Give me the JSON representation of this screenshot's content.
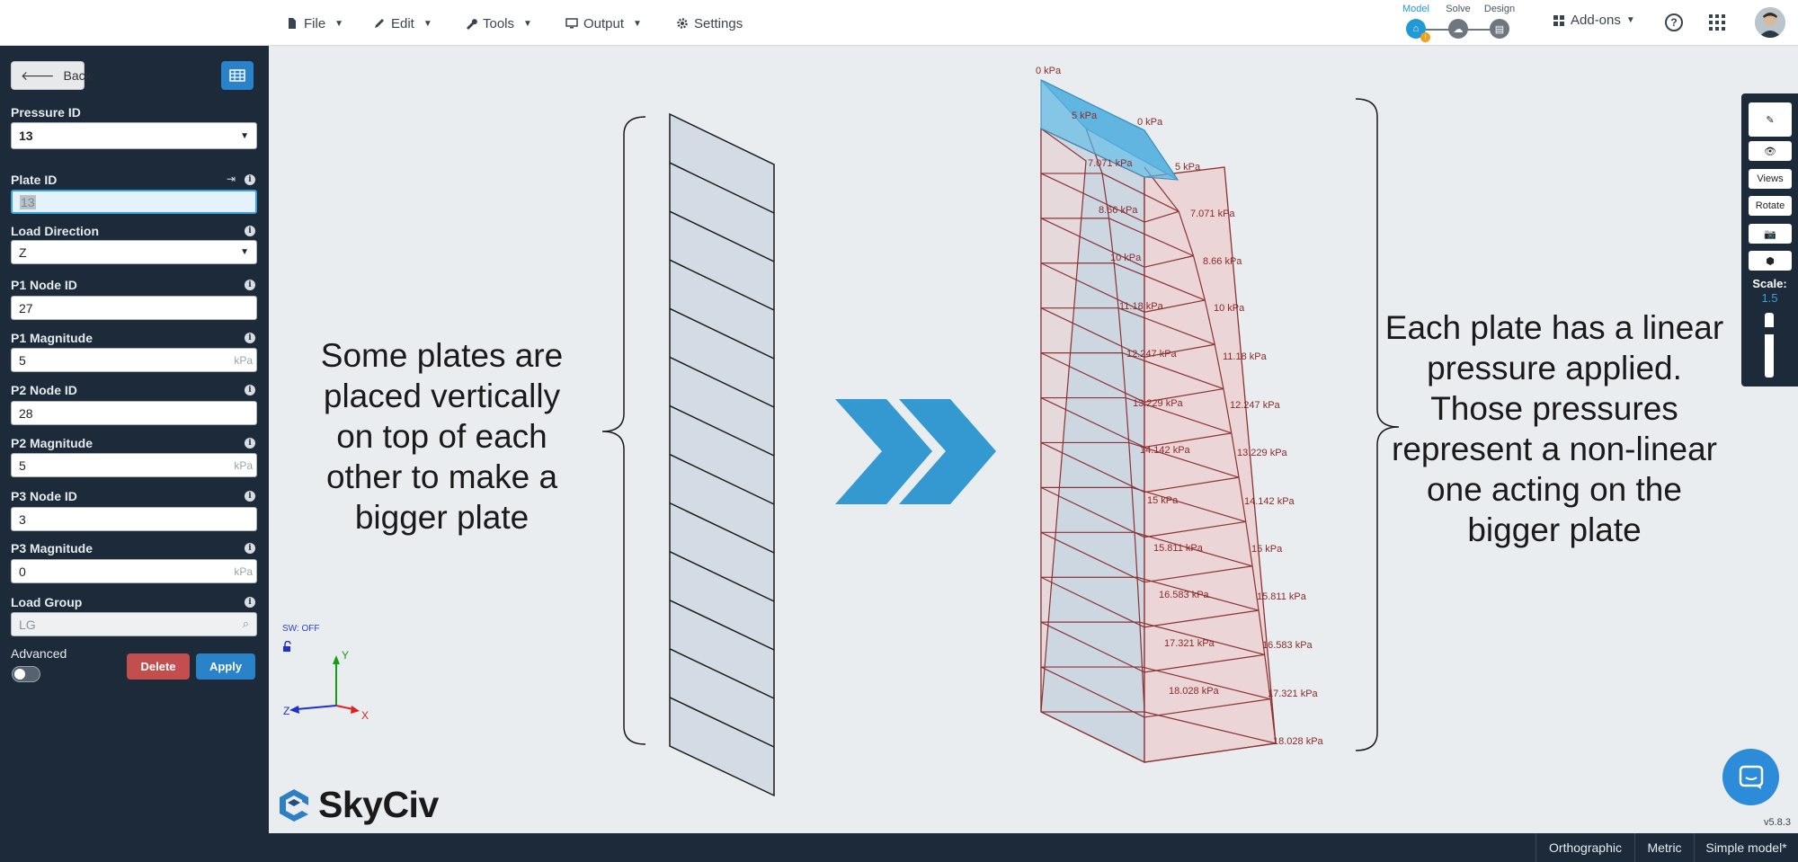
{
  "menu": {
    "file": "File",
    "edit": "Edit",
    "tools": "Tools",
    "output": "Output",
    "settings": "Settings"
  },
  "workflow": {
    "model": "Model",
    "solve": "Solve",
    "design": "Design",
    "active": "model",
    "active_color": "#1e9bd7"
  },
  "addons_label": "Add-ons",
  "help_label": "?",
  "sidebar": {
    "back_label": "Back",
    "pressure_id_label": "Pressure ID",
    "pressure_id_value": "13",
    "plate_id_label": "Plate ID",
    "plate_id_value": "13",
    "load_direction_label": "Load Direction",
    "load_direction_value": "Z",
    "p1_node_label": "P1 Node ID",
    "p1_node_value": "27",
    "p1_mag_label": "P1 Magnitude",
    "p1_mag_value": "5",
    "p2_node_label": "P2 Node ID",
    "p2_node_value": "28",
    "p2_mag_label": "P2 Magnitude",
    "p2_mag_value": "5",
    "p3_node_label": "P3 Node ID",
    "p3_node_value": "3",
    "p3_mag_label": "P3 Magnitude",
    "p3_mag_value": "0",
    "unit": "kPa",
    "load_group_label": "Load Group",
    "load_group_placeholder": "LG",
    "advanced_label": "Advanced",
    "delete_label": "Delete",
    "apply_label": "Apply",
    "delete_color": "#c24e4e",
    "apply_color": "#2a83c8"
  },
  "canvas": {
    "annotation_left": [
      "Some plates are",
      "placed vertically",
      "on top of each",
      "other to make a",
      "bigger plate"
    ],
    "annotation_right": [
      "Each plate has a linear",
      "pressure applied.",
      "Those pressures",
      "represent a non-linear",
      "one acting on the",
      "bigger plate"
    ],
    "sw_label": "SW: OFF",
    "axis_y": "Y",
    "axis_z": "Z",
    "axis_x": "X",
    "arrow_color": "#3399d0",
    "pressure_labels_left": [
      "0 kPa",
      "5 kPa",
      "7.071 kPa",
      "8.66 kPa",
      "10 kPa",
      "11.18 kPa",
      "12.247 kPa",
      "13.229 kPa",
      "14.142 kPa",
      "15 kPa",
      "15.811 kPa",
      "16.583 kPa",
      "17.321 kPa",
      "18.028 kPa"
    ],
    "pressure_labels_right": [
      "0 kPa",
      "5 kPa",
      "7.071 kPa",
      "8.66 kPa",
      "10 kPa",
      "11.18 kPa",
      "12.247 kPa",
      "13.229 kPa",
      "14.142 kPa",
      "15 kPa",
      "15.811 kPa",
      "16.583 kPa",
      "17.321 kPa",
      "18.028 kPa"
    ],
    "label_color": "#8b2a2a",
    "highlight_color": "#5ab4e0"
  },
  "right_toolbar": {
    "views_label": "Views",
    "rotate_label": "Rotate",
    "scale_label": "Scale:",
    "scale_value": "1.5"
  },
  "logo_text": "SkyCiv",
  "version": "v5.8.3",
  "statusbar": {
    "projection": "Orthographic",
    "units": "Metric",
    "model_name": "Simple model*"
  }
}
